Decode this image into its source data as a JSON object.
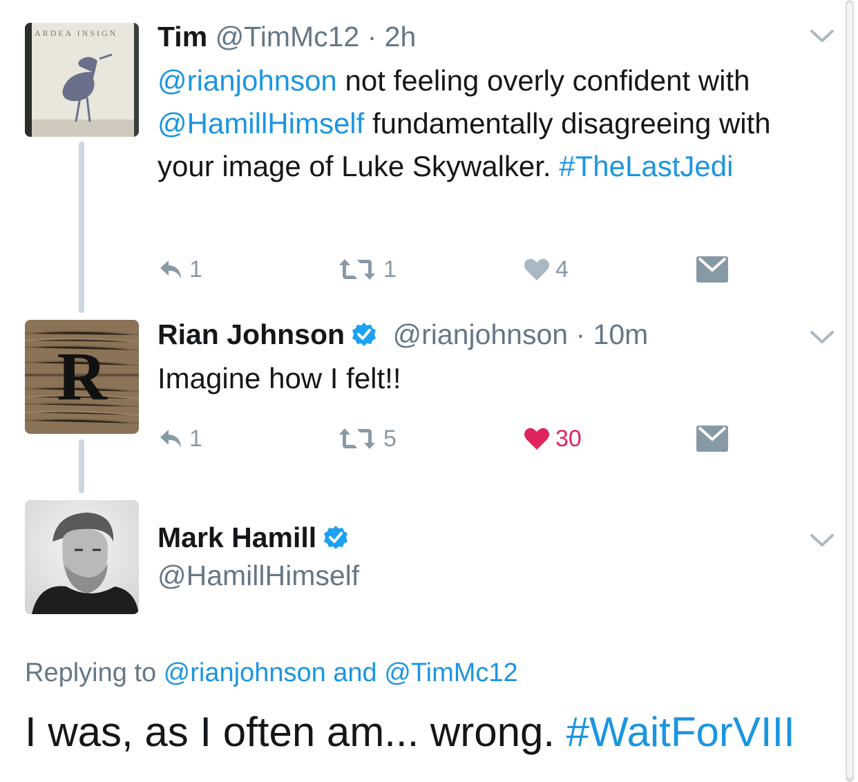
{
  "colors": {
    "link": "#1b95e0",
    "secondary": "#657786",
    "action": "#8899a6",
    "liked": "#e0245e",
    "verified": "#1da1f2"
  },
  "tweets": [
    {
      "name": "Tim",
      "handle": "@TimMc12",
      "sep": " · ",
      "time": "2h",
      "text": [
        {
          "t": "@rianjohnson",
          "link": true
        },
        {
          "t": " not feeling overly confident with ",
          "link": false
        },
        {
          "t": "@HamillHimself",
          "link": true
        },
        {
          "t": " fundamentally disagreeing with your image of Luke Skywalker. ",
          "link": false
        },
        {
          "t": "#TheLastJedi",
          "link": true
        }
      ],
      "replies": "1",
      "retweets": "1",
      "likes": "4",
      "avatar_text": "ARDEA INSIGN"
    },
    {
      "name": "Rian Johnson",
      "verified": true,
      "handle": "@rianjohnson",
      "sep": " · ",
      "time": "10m",
      "text": [
        {
          "t": "Imagine how I felt!!",
          "link": false
        }
      ],
      "replies": "1",
      "retweets": "5",
      "likes": "30",
      "liked": true,
      "avatar_text": "R"
    },
    {
      "name": "Mark Hamill",
      "verified": true,
      "handle": "@HamillHimself",
      "replying_prefix": "Replying to ",
      "replying_to_1": "@rianjohnson",
      "replying_and": " and ",
      "replying_to_2": "@TimMc12",
      "text": [
        {
          "t": "I was, as I often am... wrong. ",
          "link": false
        },
        {
          "t": "#WaitForVIII",
          "link": true
        }
      ]
    }
  ],
  "icons": [
    "reply-icon",
    "retweet-icon",
    "like-icon",
    "direct-message-icon",
    "chevron-down-icon",
    "verified-badge-icon"
  ]
}
